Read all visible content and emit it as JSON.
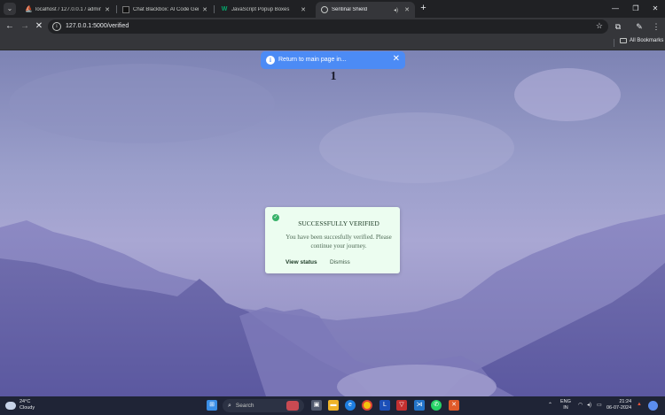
{
  "browser": {
    "tabs": [
      {
        "title": "localhost / 127.0.0.1 / admin_db /",
        "active": false
      },
      {
        "title": "Chat Blackbox: AI Code Generation",
        "active": false
      },
      {
        "title": "JavaScript Popup Boxes",
        "active": false
      },
      {
        "title": "Sentinal Shield",
        "active": true
      }
    ],
    "new_tab": "+",
    "url": "127.0.0.1:5000/verified",
    "bookmarks_label": "All Bookmarks"
  },
  "page": {
    "toast": {
      "message": "Return to main page in...",
      "icon": "info-icon"
    },
    "countdown": "1",
    "dialog": {
      "title": "SUCCESSFULLY VERIFIED",
      "body": "You have been succesfully verified. Please continue your journey.",
      "primary": "View status",
      "secondary": "Dismiss"
    }
  },
  "taskbar": {
    "weather_temp": "24°C",
    "weather_desc": "Cloudy",
    "search": "Search",
    "lang_line1": "ENG",
    "lang_line2": "IN",
    "time": "21:24",
    "date": "06-07-2024"
  },
  "colors": {
    "accent_blue": "#4c8bf5",
    "dialog_bg": "#ecfdf0",
    "success": "#38b26a"
  }
}
